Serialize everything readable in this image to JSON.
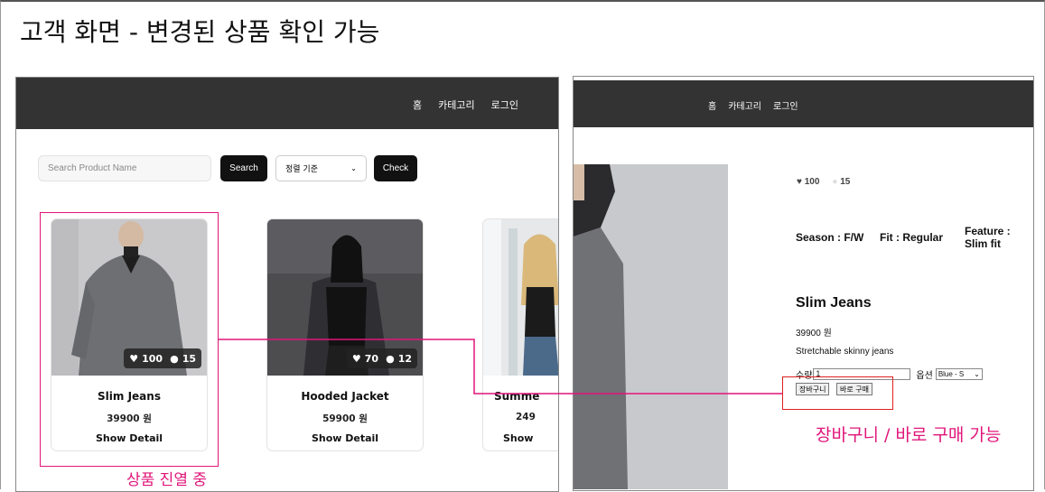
{
  "slide_title": "고객 화면 - 변경된 상품 확인 가능",
  "left_panel": {
    "nav": [
      "홈",
      "카테고리",
      "로그인"
    ],
    "search": {
      "placeholder": "Search Product Name",
      "button": "Search"
    },
    "sort": {
      "selected": "정렬 기준",
      "button": "Check"
    },
    "products": [
      {
        "name": "Slim Jeans",
        "price": "39900 원",
        "likes": "100",
        "comments": "15",
        "detail": "Show Detail"
      },
      {
        "name": "Hooded Jacket",
        "price": "59900 원",
        "likes": "70",
        "comments": "12",
        "detail": "Show Detail"
      },
      {
        "name": "Summe",
        "price": "249",
        "detail": "Show"
      }
    ],
    "caption": "상품 진열 중"
  },
  "right_panel": {
    "nav": [
      "홈",
      "카테고리",
      "로그인"
    ],
    "likes": "100",
    "comments": "15",
    "season": "Season : F/W",
    "fit": "Fit : Regular",
    "feature_line1": "Feature :",
    "feature_line2": "Slim fit",
    "name": "Slim Jeans",
    "price": "39900 원",
    "description": "Stretchable skinny jeans",
    "qty_label": "수량",
    "qty_value": "1",
    "option_label": "옵션",
    "option_value": "Blue - S",
    "cart_button": "장바구니",
    "buy_button": "바로 구매",
    "caption": "장바구니 / 바로 구매 가능"
  },
  "colors": {
    "nav": "#333333",
    "highlight_pink": "#e0157a",
    "highlight_red": "#e02020"
  },
  "icons": [
    "heart-icon",
    "comment-icon",
    "chevron-down-icon"
  ]
}
